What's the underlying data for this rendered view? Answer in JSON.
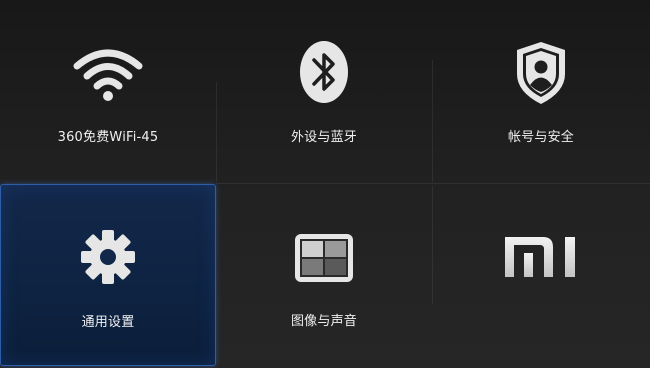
{
  "tiles": [
    {
      "label": "360免费WiFi-45",
      "icon": "wifi-icon"
    },
    {
      "label": "外设与蓝牙",
      "icon": "bluetooth-icon"
    },
    {
      "label": "帐号与安全",
      "icon": "account-security-icon"
    },
    {
      "label": "通用设置",
      "icon": "gear-icon",
      "selected": true
    },
    {
      "label": "图像与声音",
      "icon": "picture-sound-icon"
    },
    {
      "label": "",
      "icon": "mi-logo-icon"
    }
  ],
  "colors": {
    "background": "#1c1c1c",
    "selection_fill": "#0e2342",
    "selection_border": "#2f5ea8",
    "icon": "#e6e6e6"
  }
}
